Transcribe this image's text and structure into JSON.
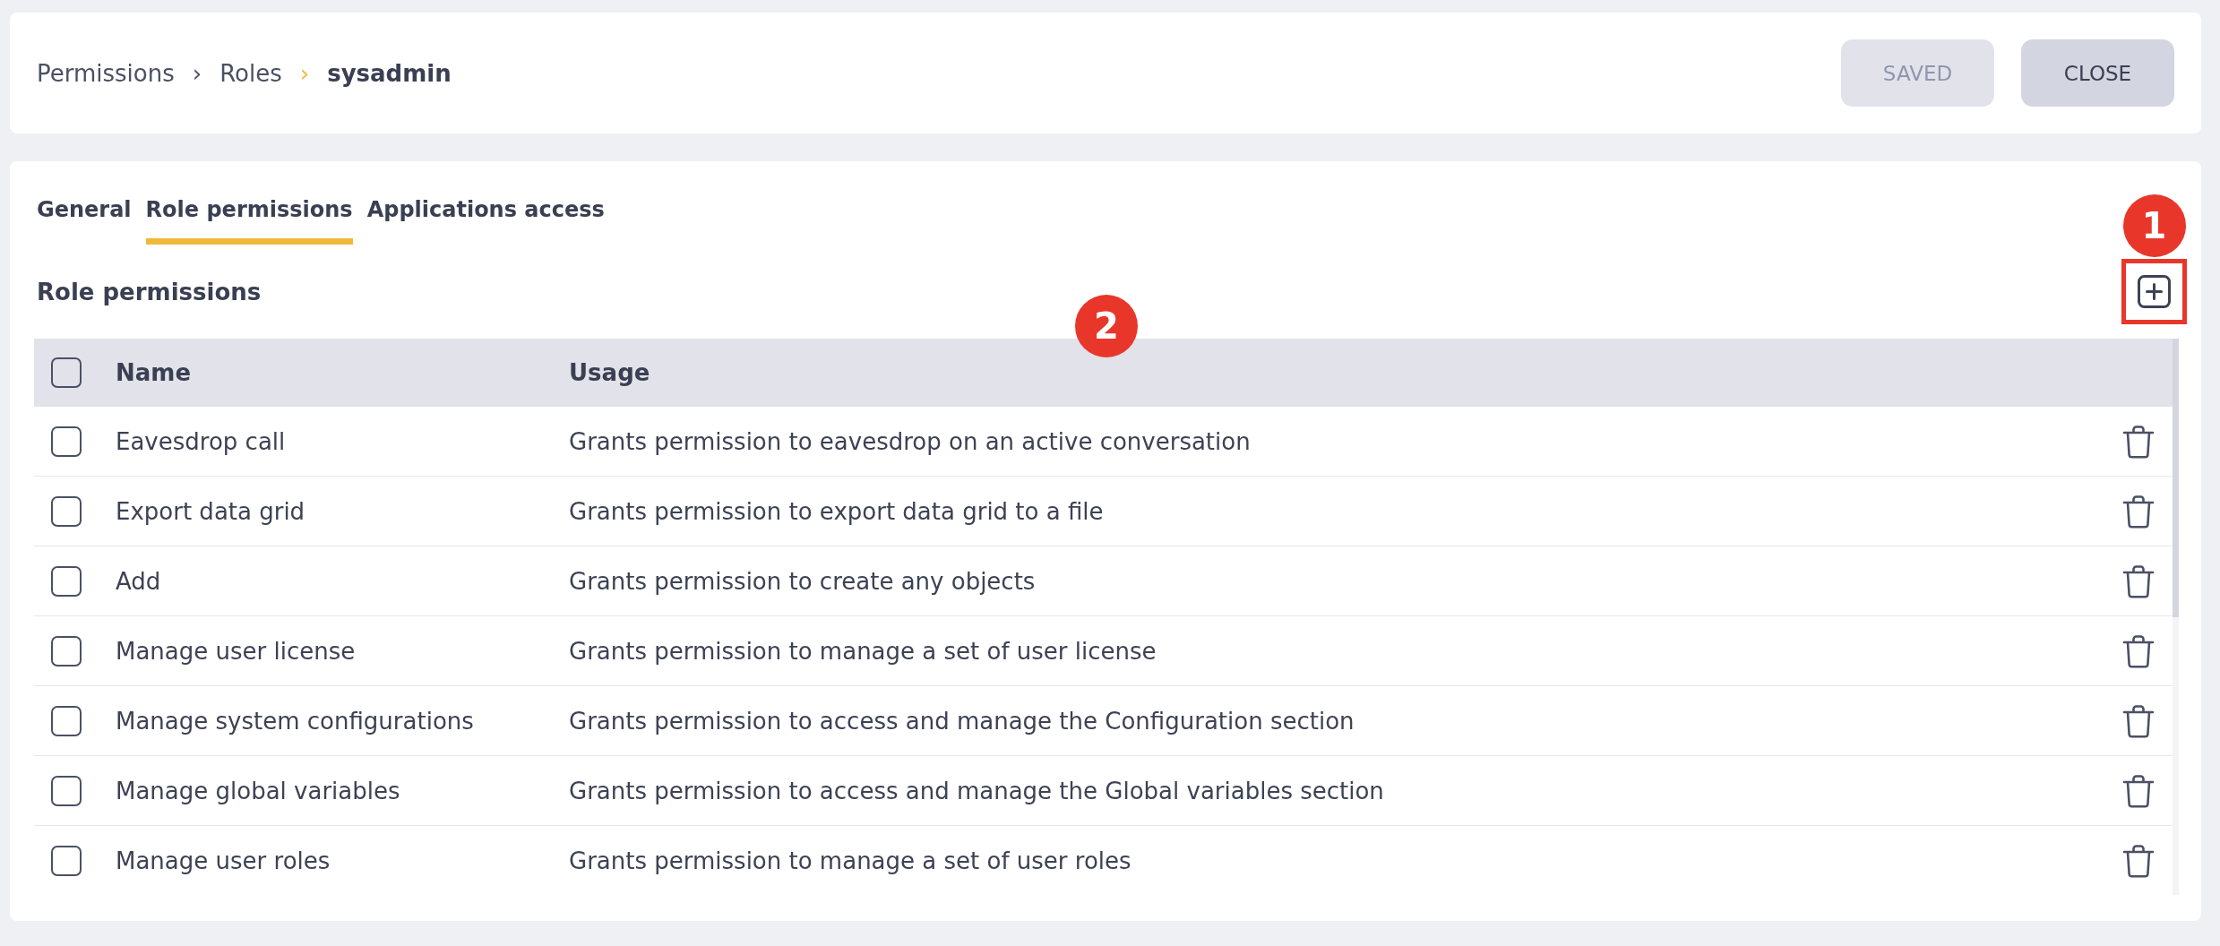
{
  "header": {
    "breadcrumb": [
      {
        "label": "Permissions",
        "current": false,
        "separator": "›"
      },
      {
        "label": "Roles",
        "current": false,
        "separator": "›"
      },
      {
        "label": "sysadmin",
        "current": true
      }
    ],
    "buttons": [
      {
        "label": "SAVED",
        "disabled": true
      },
      {
        "label": "CLOSE",
        "disabled": false
      }
    ]
  },
  "tabs": [
    {
      "label": "General",
      "selected": false
    },
    {
      "label": "Role permissions",
      "selected": true
    },
    {
      "label": "Applications access",
      "selected": false
    }
  ],
  "section": {
    "title": "Role permissions",
    "add_callout": "1"
  },
  "table": {
    "callout": "2",
    "all_checked": false,
    "columns": [
      "Name",
      "Usage"
    ],
    "rows": [
      {
        "name": "Eavesdrop call",
        "usage": "Grants permission to eavesdrop on an active conversation",
        "checked": false
      },
      {
        "name": "Export data grid",
        "usage": "Grants permission to export data grid to a file",
        "checked": false
      },
      {
        "name": "Add",
        "usage": "Grants permission to create any objects",
        "checked": false
      },
      {
        "name": "Manage user license",
        "usage": "Grants permission to manage a set of user license",
        "checked": false
      },
      {
        "name": "Manage system configurations",
        "usage": "Grants permission to access and manage the Configuration section",
        "checked": false
      },
      {
        "name": "Manage global variables",
        "usage": "Grants permission to access and manage the Global variables section",
        "checked": false
      },
      {
        "name": "Manage user roles",
        "usage": "Grants permission to manage a set of user roles",
        "checked": false
      }
    ]
  }
}
